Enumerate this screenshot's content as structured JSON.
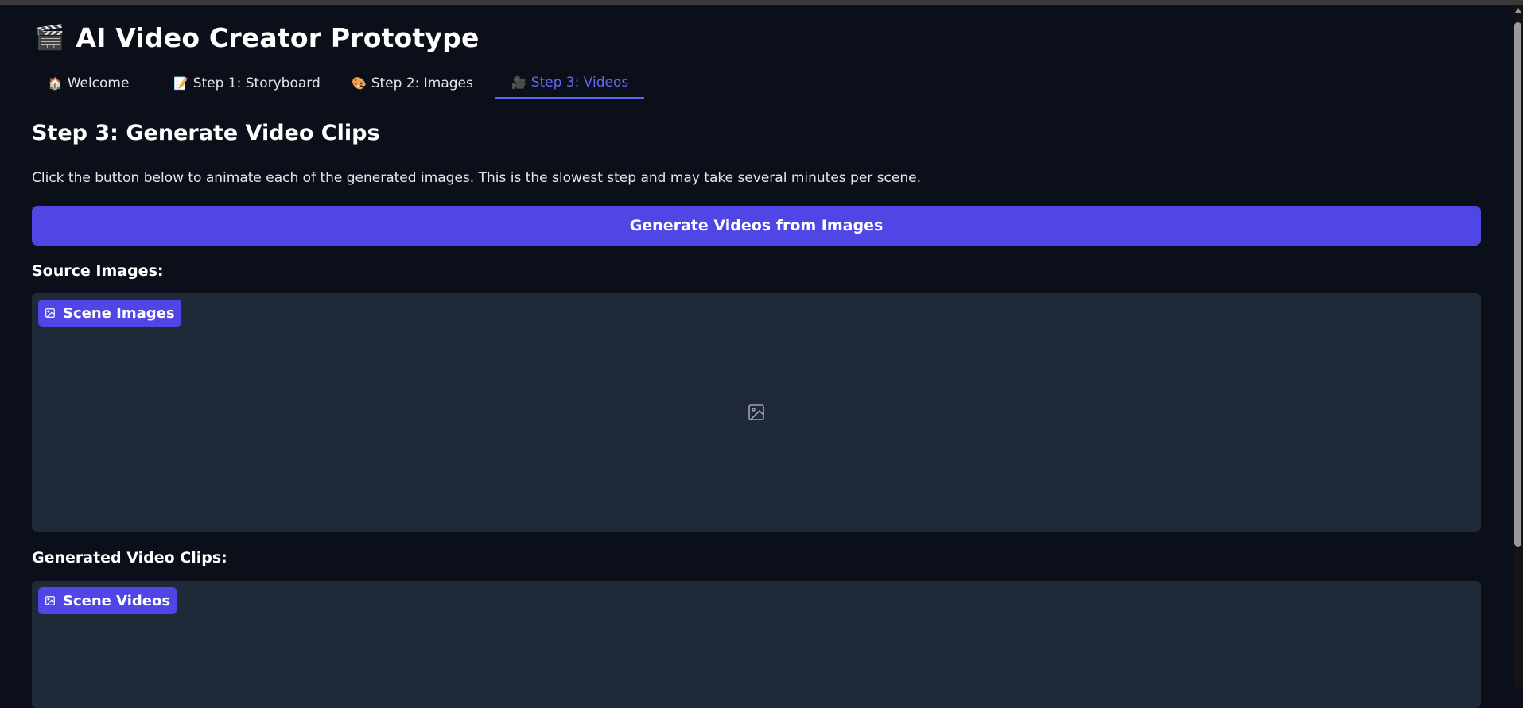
{
  "app": {
    "title_emoji": "🎬",
    "title": "AI Video Creator Prototype"
  },
  "tabs": [
    {
      "icon": "🏠",
      "label": "Welcome"
    },
    {
      "icon": "📝",
      "label": "Step 1: Storyboard"
    },
    {
      "icon": "🎨",
      "label": "Step 2: Images"
    },
    {
      "icon": "🎥",
      "label": "Step 3: Videos",
      "active": true
    }
  ],
  "main": {
    "heading": "Step 3: Generate Video Clips",
    "description": "Click the button below to animate each of the generated images. This is the slowest step and may take several minutes per scene.",
    "generate_button": "Generate Videos from Images",
    "source_label": "Source Images:",
    "source_gallery_badge": "Scene Images",
    "videos_label": "Generated Video Clips:",
    "videos_gallery_badge": "Scene Videos"
  },
  "colors": {
    "background": "#0b0f19",
    "panel": "#1f2937",
    "accent": "#4f46e5",
    "active_tab": "#6366f1"
  }
}
